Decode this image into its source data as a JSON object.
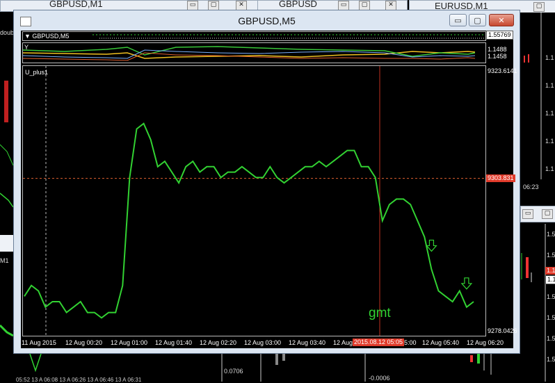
{
  "background_windows": {
    "left_top_title": "GBPUSD,M1",
    "center_top_title": "GBPUSD",
    "right_top_title": "EURUSD,M1",
    "left_label_doub": "doub",
    "left_label_m1": "M1",
    "bottom_value_left": "0.0706",
    "bottom_value_center": "-0.0006",
    "right_time": "06:23",
    "right_price_prefix": "1.1",
    "right_price_prefix2": "1.5",
    "bottom_times": [
      "05:52",
      "13 A",
      "06:08",
      "13 A",
      "06:26",
      "13 A",
      "06:46",
      "13 A",
      "06:31"
    ]
  },
  "main_window": {
    "title": "GBPUSD,M5",
    "buttons": {
      "minimize": "▭",
      "maximize": "▢",
      "close": "✕"
    }
  },
  "price_pane": {
    "label": "▼ GBPUSD,M5",
    "current_price": "1.55769"
  },
  "indicator_pane": {
    "label": "Y",
    "levels": [
      "1.1488",
      "1.1458"
    ],
    "colors": [
      "#f0c020",
      "#39c839",
      "#7ab0ff",
      "#e06030"
    ]
  },
  "main_pane": {
    "label": "U_plus1",
    "max_value": "9323.6141",
    "min_value": "9278.0426",
    "current_value": "9303.831",
    "annotation": "gmt",
    "highlighted_time": "2015.08.12 05:05",
    "line_color": "#32d232"
  },
  "time_axis": [
    "11 Aug 2015",
    "12 Aug 00:20",
    "12 Aug 01:00",
    "12 Aug 01:40",
    "12 Aug 02:20",
    "12 Aug 03:00",
    "12 Aug 03:40",
    "12 Aug 04",
    "5:00",
    "12 Aug 05:40",
    "12 Aug 06:20"
  ],
  "chart_data": {
    "type": "line",
    "series": [
      {
        "values": [
          9282,
          9284,
          9283,
          9280,
          9281,
          9281,
          9279,
          9280,
          9281,
          9279,
          9279,
          9278,
          9279,
          9279,
          9284,
          9304,
          9313,
          9314,
          9311,
          9306,
          9307,
          9305,
          9303,
          9306,
          9307,
          9305,
          9306,
          9306,
          9304,
          9305,
          9305,
          9306,
          9305,
          9304,
          9304,
          9306,
          9304,
          9303,
          9304,
          9305,
          9306,
          9306,
          9307,
          9306,
          9307,
          9308,
          9309,
          9309,
          9306,
          9306,
          9304,
          9296,
          9299,
          9300,
          9300,
          9299,
          9296,
          9293,
          9287,
          9283,
          9282,
          9281,
          9283,
          9280,
          9281
        ]
      }
    ],
    "ylim": [
      9278.0426,
      9323.6141
    ],
    "current": 9303.831,
    "markers": [
      {
        "type": "down-arrow",
        "index": 58
      },
      {
        "type": "down-arrow",
        "index": 63
      }
    ]
  }
}
